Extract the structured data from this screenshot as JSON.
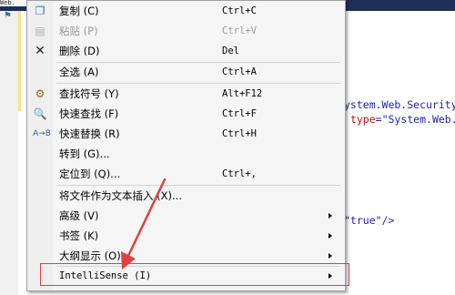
{
  "editor": {
    "tab_text": "Web.",
    "code_lines": [
      "ystem.Web.Security.",
      "\"true\"/>"
    ],
    "code_line2_attr": "type",
    "code_line2_value": "=\"System.Web."
  },
  "menu": {
    "items": [
      {
        "label": "复制 (C)",
        "shortcut": "Ctrl+C",
        "icon": "copy-icon",
        "disabled": false
      },
      {
        "label": "粘贴 (P)",
        "shortcut": "Ctrl+V",
        "icon": "paste-icon",
        "disabled": true
      },
      {
        "label": "删除 (D)",
        "shortcut": "Del",
        "icon": "delete-icon",
        "disabled": false
      },
      {
        "label": "全选 (A)",
        "shortcut": "Ctrl+A",
        "icon": "",
        "disabled": false
      },
      {
        "label": "查找符号 (Y)",
        "shortcut": "Alt+F12",
        "icon": "find-symbol-icon",
        "disabled": false
      },
      {
        "label": "快速查找 (F)",
        "shortcut": "Ctrl+F",
        "icon": "quick-find-icon",
        "disabled": false
      },
      {
        "label": "快速替换 (R)",
        "shortcut": "Ctrl+H",
        "icon": "quick-replace-icon",
        "disabled": false
      },
      {
        "label": "转到 (G)...",
        "shortcut": "",
        "icon": "",
        "disabled": false
      },
      {
        "label": "定位到 (Q)...",
        "shortcut": "Ctrl+,",
        "icon": "",
        "disabled": false
      },
      {
        "label": "将文件作为文本插入 (X)...",
        "shortcut": "",
        "icon": "",
        "disabled": false
      },
      {
        "label": "高级 (V)",
        "shortcut": "",
        "icon": "",
        "disabled": false,
        "submenu": true
      },
      {
        "label": "书签 (K)",
        "shortcut": "",
        "icon": "",
        "disabled": false,
        "submenu": true
      },
      {
        "label": "大纲显示 (O)",
        "shortcut": "",
        "icon": "",
        "disabled": false,
        "submenu": true
      },
      {
        "label": "IntelliSense (I)",
        "shortcut": "",
        "icon": "",
        "disabled": false,
        "submenu": true
      }
    ]
  },
  "colors": {
    "annotation": "#e04040",
    "menu_bg": "#f5f5f5",
    "code_blue": "#1f1fb0",
    "code_red": "#c01010"
  }
}
